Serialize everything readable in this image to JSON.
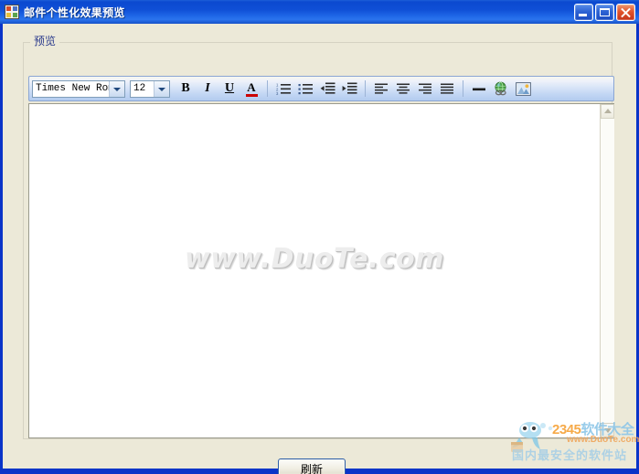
{
  "window": {
    "title": "邮件个性化效果预览",
    "icon": "app-window-icon",
    "caption_buttons": [
      {
        "name": "minimize",
        "label": "最小化"
      },
      {
        "name": "maximize",
        "label": "最大化"
      },
      {
        "name": "close",
        "label": "关闭"
      }
    ],
    "title_bar_color": "#0b49d0",
    "client_background": "#ece9d8",
    "border_color": "#0a34c8"
  },
  "groupbox": {
    "label": "预览"
  },
  "toolbar": {
    "font_family": {
      "value": "Times New Rom",
      "placeholder": "Times New Roman"
    },
    "font_size": {
      "value": "12",
      "placeholder": "12"
    },
    "buttons": [
      {
        "name": "bold-button",
        "icon": "bold-icon",
        "label": "B"
      },
      {
        "name": "italic-button",
        "icon": "italic-icon",
        "label": "I"
      },
      {
        "name": "underline-button",
        "icon": "underline-icon",
        "label": "U"
      },
      {
        "name": "font-color-button",
        "icon": "font-color-icon",
        "label": "A",
        "color": "#cc0000"
      },
      {
        "name": "numbered-list-button",
        "icon": "numbered-list-icon",
        "label": ""
      },
      {
        "name": "bulleted-list-button",
        "icon": "bulleted-list-icon",
        "label": ""
      },
      {
        "name": "decrease-indent-button",
        "icon": "decrease-indent-icon",
        "label": ""
      },
      {
        "name": "increase-indent-button",
        "icon": "increase-indent-icon",
        "label": ""
      },
      {
        "name": "align-left-button",
        "icon": "align-left-icon",
        "label": ""
      },
      {
        "name": "align-center-button",
        "icon": "align-center-icon",
        "label": ""
      },
      {
        "name": "align-right-button",
        "icon": "align-right-icon",
        "label": ""
      },
      {
        "name": "align-justify-button",
        "icon": "align-justify-icon",
        "label": ""
      },
      {
        "name": "horizontal-rule-button",
        "icon": "horizontal-rule-icon",
        "label": ""
      },
      {
        "name": "insert-link-button",
        "icon": "globe-link-icon",
        "label": ""
      },
      {
        "name": "insert-image-button",
        "icon": "image-icon",
        "label": ""
      }
    ]
  },
  "editor": {
    "content": "",
    "watermark": "www.DuoTe.com",
    "scrollbar": {
      "up_arrow": "scroll-up-arrow",
      "down_arrow": "scroll-down-arrow"
    }
  },
  "footer": {
    "refresh_button": "刷新"
  },
  "logo": {
    "brand_number": "2345",
    "brand_name": "软件大全",
    "url": "www.DuoTe.com",
    "tagline": "国内最安全的软件站"
  }
}
